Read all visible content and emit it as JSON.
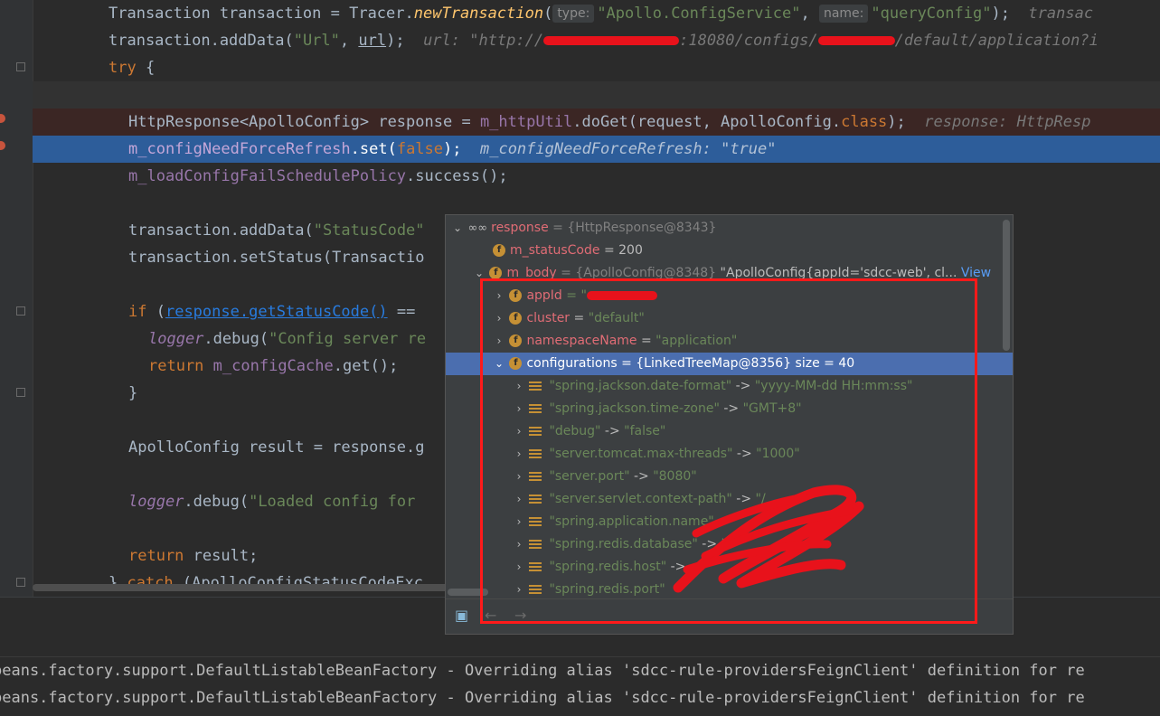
{
  "editor": {
    "line1": {
      "text_a": "Transaction transaction = Tracer.",
      "method": "newTransaction",
      "paren": "(",
      "chip1": "type:",
      "str1": "\"Apollo.ConfigService\"",
      "comma": ", ",
      "chip2": "name:",
      "str2": "\"queryConfig\"",
      "end": ");",
      "hint": "transac"
    },
    "line2": {
      "text_a": "transaction.addData(",
      "str": "\"Url\"",
      "text_b": ", ",
      "var": "url",
      "end": ");",
      "hint_a": "url: \"http://",
      "hint_b": ":18080/configs/",
      "hint_c": "/default/application?i"
    },
    "line3": {
      "kw": "try",
      "text": " {"
    },
    "line5": {
      "text_a": "HttpResponse<ApolloConfig> response = ",
      "field": "m_httpUtil",
      "text_b": ".doGet(request, ApolloConfig.",
      "kw": "class",
      "end": ");",
      "hint": "response: HttpResp"
    },
    "line6": {
      "field": "m_configNeedForceRefresh",
      "text_b": ".set(",
      "kw": "false",
      "end": ");",
      "hint": "m_configNeedForceRefresh: \"true\""
    },
    "line7": {
      "field": "m_loadConfigFailSchedulePolicy",
      "text_b": ".success();"
    },
    "line9": {
      "text_a": "transaction.addData(",
      "str": "\"StatusCode\""
    },
    "line10": {
      "text_a": "transaction.setStatus(Transactio"
    },
    "line12": {
      "kw": "if",
      "text_a": " (",
      "link": "response.getStatusCode()",
      "text_b": " =="
    },
    "line13": {
      "field": "logger",
      "text_b": ".debug(",
      "str": "\"Config server re"
    },
    "line14": {
      "kw": "return",
      "text_a": " ",
      "field": "m_configCache",
      "text_b": ".get();"
    },
    "line15": {
      "text": "}"
    },
    "line17": {
      "text": "ApolloConfig result = response.g"
    },
    "line19": {
      "field": "logger",
      "text_b": ".debug(",
      "str": "\"Loaded config for"
    },
    "line21": {
      "kw": "return",
      "text": " result;"
    },
    "line22": {
      "text_a": "} ",
      "kw": "catch",
      "text_b": " (ApolloConfigStatusCodeExc"
    }
  },
  "debugger": {
    "rows": [
      {
        "name": "response",
        "value": "= {HttpResponse@8343}",
        "extra": ""
      },
      {
        "name": "m_statusCode",
        "value": "= 200",
        "extra": ""
      },
      {
        "name": "m_body",
        "value": "= {ApolloConfig@8348}",
        "extra": "\"ApolloConfig{appId='sdcc-web', cl...",
        "view": "View"
      },
      {
        "name": "appId",
        "value": "= \"",
        "extra": ""
      },
      {
        "name": "cluster",
        "value": "= ",
        "extra": "\"default\""
      },
      {
        "name": "namespaceName",
        "value": "= ",
        "extra": "\"application\""
      },
      {
        "name": "configurations",
        "value": "= {LinkedTreeMap@8356}",
        "extra": "size = 40"
      }
    ],
    "entries": [
      {
        "key": "\"spring.jackson.date-format\"",
        "arrow": " -> ",
        "value": "\"yyyy-MM-dd HH:mm:ss\""
      },
      {
        "key": "\"spring.jackson.time-zone\"",
        "arrow": " -> ",
        "value": "\"GMT+8\""
      },
      {
        "key": "\"debug\"",
        "arrow": " -> ",
        "value": "\"false\""
      },
      {
        "key": "\"server.tomcat.max-threads\"",
        "arrow": " -> ",
        "value": "\"1000\""
      },
      {
        "key": "\"server.port\"",
        "arrow": " -> ",
        "value": "\"8080\""
      },
      {
        "key": "\"server.servlet.context-path\"",
        "arrow": " -> ",
        "value": "\"/"
      },
      {
        "key": "\"spring.application.name\"",
        "arrow": " ->",
        "value": ""
      },
      {
        "key": "\"spring.redis.database\"",
        "arrow": " -> ",
        "value": "\""
      },
      {
        "key": "\"spring.redis.host\"",
        "arrow": " ->",
        "value": ""
      },
      {
        "key": "\"spring.redis.port\"",
        "arrow": "",
        "value": ""
      }
    ],
    "toolbar": {
      "back": "←",
      "forward": "→"
    }
  },
  "console": {
    "lines": [
      "beans.factory.support.DefaultListableBeanFactory - Overriding alias 'sdcc-rule-providersFeignClient' definition for re",
      "beans.factory.support.DefaultListableBeanFactory - Overriding alias 'sdcc-rule-providersFeignClient' definition for re"
    ]
  },
  "colors": {
    "background": "#2b2b2b",
    "selection": "#2d5d9a",
    "annotation": "#ff1a1a",
    "popup": "#3c3f41"
  },
  "icons": [
    "glasses-icon",
    "field-icon",
    "list-entry-icon",
    "chevron-right-icon",
    "chevron-down-icon",
    "breakpoint-icon",
    "fold-icon",
    "popup-toolbar-icon",
    "back-arrow-icon",
    "forward-arrow-icon"
  ]
}
